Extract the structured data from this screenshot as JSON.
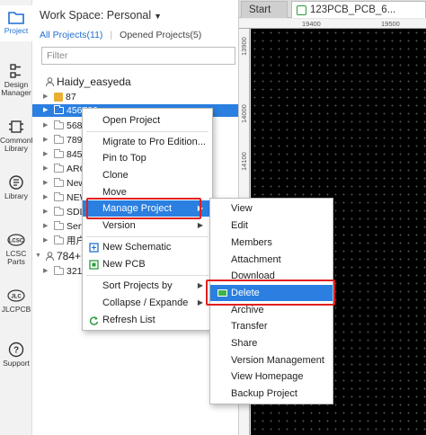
{
  "rail": {
    "items": [
      {
        "label": "Project",
        "icon": "folder-icon"
      },
      {
        "label": "Design Manager",
        "icon": "design-manager-icon"
      },
      {
        "label": "Commonly Library",
        "icon": "chip-icon"
      },
      {
        "label": "Library",
        "icon": "library-icon"
      },
      {
        "label": "LCSC Parts",
        "icon": "lcsc-logo-icon"
      },
      {
        "label": "JLCPCB",
        "icon": "jlc-logo-icon"
      },
      {
        "label": "Support",
        "icon": "help-icon"
      }
    ]
  },
  "panel": {
    "workspace_title": "Work Space: Personal",
    "tabs": {
      "all": "All Projects(11)",
      "separator": "|",
      "opened": "Opened Projects(5)"
    },
    "filter_placeholder": "Filter",
    "tree": [
      {
        "label": "Haidy_easyeda",
        "kind": "user"
      },
      {
        "label": "87",
        "kind": "locked-folder"
      },
      {
        "label": "456789",
        "kind": "folder",
        "selected": true
      },
      {
        "label": "5688",
        "kind": "folder"
      },
      {
        "label": "7894",
        "kind": "folder"
      },
      {
        "label": "8454",
        "kind": "folder"
      },
      {
        "label": "ARC",
        "kind": "folder"
      },
      {
        "label": "New",
        "kind": "folder"
      },
      {
        "label": "NEW",
        "kind": "folder"
      },
      {
        "label": "SDL",
        "kind": "folder"
      },
      {
        "label": "Serv",
        "kind": "folder"
      },
      {
        "label": "用户",
        "kind": "folder"
      },
      {
        "label": "784+",
        "kind": "user"
      },
      {
        "label": "3216",
        "kind": "folder"
      }
    ]
  },
  "canvas": {
    "tab_start": "Start",
    "tab_pcb": "123PCB_PCB_6...",
    "ruler_top": [
      "19400",
      "19500"
    ],
    "ruler_left": [
      "13900",
      "14000",
      "14100"
    ]
  },
  "context_menu": {
    "items": [
      {
        "label": "Open Project"
      },
      {
        "label": "Migrate to Pro Edition..."
      },
      {
        "label": "Pin to Top"
      },
      {
        "label": "Clone"
      },
      {
        "label": "Move"
      },
      {
        "label": "Manage Project",
        "submenu": true,
        "highlighted": true
      },
      {
        "label": "Version",
        "submenu": true
      },
      {
        "label": "New Schematic",
        "icon": "new-schematic-icon"
      },
      {
        "label": "New PCB",
        "icon": "new-pcb-icon"
      },
      {
        "label": "Sort Projects by",
        "submenu": true
      },
      {
        "label": "Collapse / Expande",
        "submenu": true
      },
      {
        "label": "Refresh List",
        "icon": "refresh-icon"
      }
    ]
  },
  "submenu": {
    "items": [
      {
        "label": "View"
      },
      {
        "label": "Edit"
      },
      {
        "label": "Members"
      },
      {
        "label": "Attachment"
      },
      {
        "label": "Download"
      },
      {
        "label": "Delete",
        "highlighted": true
      },
      {
        "label": "Archive"
      },
      {
        "label": "Transfer"
      },
      {
        "label": "Share"
      },
      {
        "label": "Version Management"
      },
      {
        "label": "View Homepage"
      },
      {
        "label": "Backup Project"
      }
    ]
  },
  "colors": {
    "accent": "#2a7fe0",
    "highlight_box": "#e02020",
    "canvas_bg": "#000000"
  }
}
